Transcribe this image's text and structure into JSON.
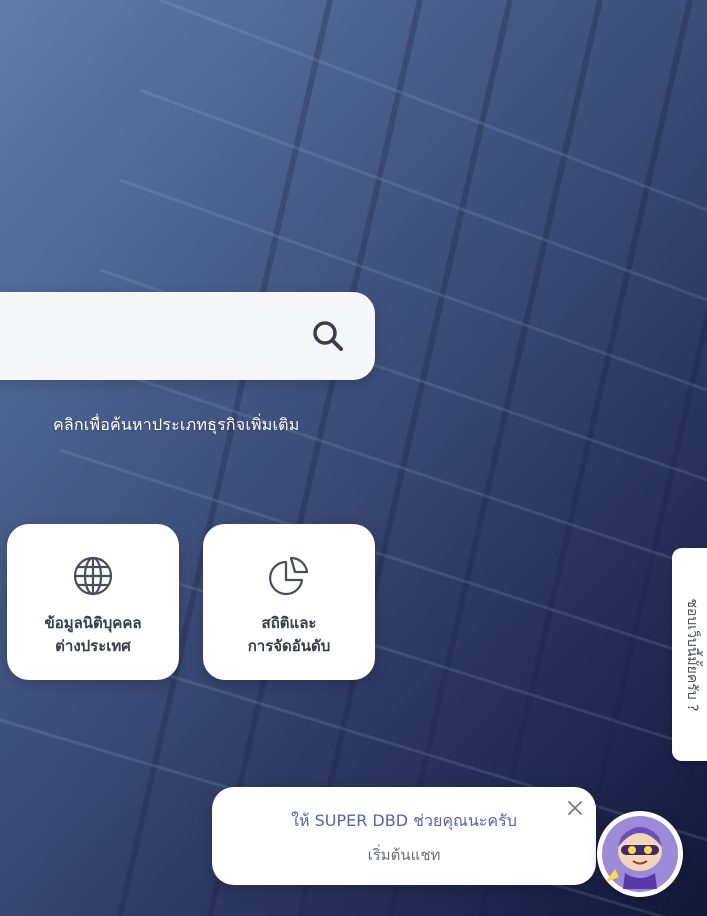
{
  "search": {
    "button_icon": "search-icon",
    "more_link": "คลิกเพื่อค้นหาประเภทธุรกิจเพิ่มเติม"
  },
  "cards": [
    {
      "icon": "globe-icon",
      "line1": "ข้อมูลนิติบุคคล",
      "line2": "ต่างประเทศ"
    },
    {
      "icon": "pie-chart-icon",
      "line1": "สถิติและ",
      "line2": "การจัดอันดับ"
    }
  ],
  "feedback": {
    "label": "ชอบเว็บนี้มั้ยครับ ?"
  },
  "chat": {
    "title": "ให้ SUPER DBD ช่วยคุณนะครับ",
    "subtitle": "เริ่มต้นแชท",
    "close_icon": "close-icon",
    "avatar_icon": "mascot-avatar-icon"
  },
  "colors": {
    "accent": "#5b5eb8",
    "card_text": "#3a3d4a",
    "background_dark": "#1e2452"
  }
}
